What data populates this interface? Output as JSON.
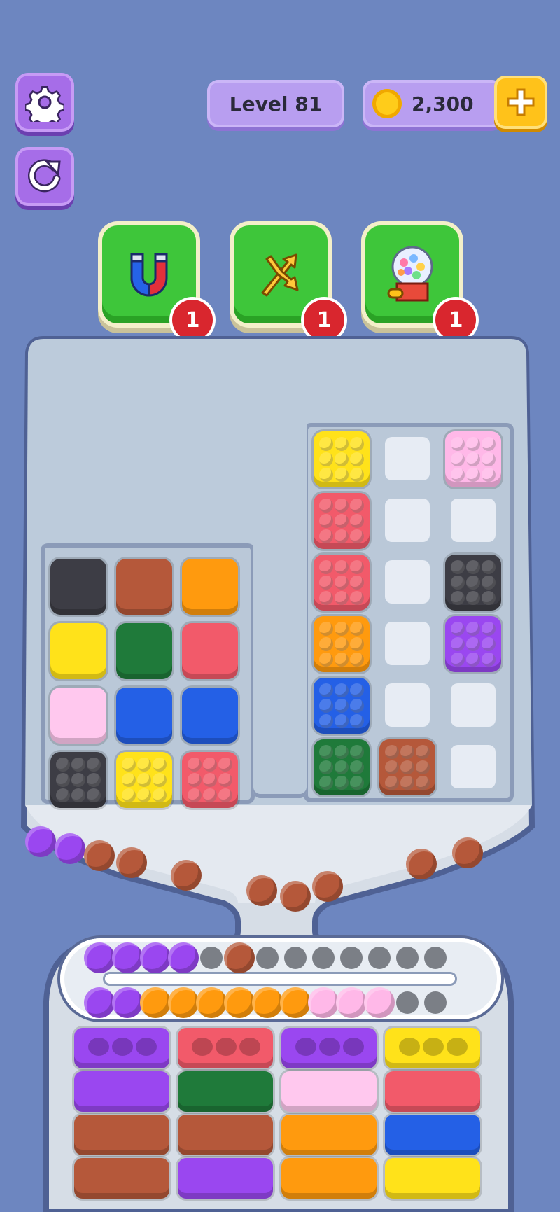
{
  "hud": {
    "level_label": "Level 81",
    "coins": "2,300",
    "settings_icon": "gear-icon",
    "restart_icon": "restart-icon",
    "coin_icon": "coin-icon",
    "add_icon": "plus-icon"
  },
  "boosters": [
    {
      "icon": "magnet-icon",
      "count": "1"
    },
    {
      "icon": "shuffle-arrows-icon",
      "count": "1"
    },
    {
      "icon": "gumball-machine-icon",
      "count": "1"
    }
  ],
  "colors": {
    "black": "#3d3d45",
    "brown": "#b5583a",
    "orange": "#ff9a0e",
    "yellow": "#ffe21a",
    "green": "#1f7a3a",
    "red": "#f25a6a",
    "pink": "#ffc8ee",
    "blue": "#2460e6",
    "purple": "#9a47f0",
    "light_pink": "#ffb8e8"
  },
  "left_grid": [
    [
      "black",
      "brown",
      "orange"
    ],
    [
      "yellow",
      "green",
      "red"
    ],
    [
      "pink",
      "blue",
      "blue"
    ],
    [
      "black",
      "yellow",
      "red"
    ]
  ],
  "right_grid": [
    [
      "yellow",
      "empty",
      "light_pink"
    ],
    [
      "red",
      "empty",
      "empty"
    ],
    [
      "red",
      "empty",
      "black"
    ],
    [
      "orange",
      "empty",
      "purple"
    ],
    [
      "blue",
      "empty",
      "empty"
    ],
    [
      "green",
      "brown",
      "empty"
    ]
  ],
  "conveyor": {
    "row1": [
      "purple",
      "purple",
      "purple",
      "purple",
      "hole",
      "brown",
      "hole",
      "hole",
      "hole",
      "hole",
      "hole",
      "hole",
      "hole"
    ],
    "row2": [
      "purple",
      "purple",
      "orange",
      "orange",
      "orange",
      "orange",
      "orange",
      "orange",
      "light_pink",
      "light_pink",
      "light_pink",
      "hole",
      "hole"
    ]
  },
  "trays": [
    [
      "purple",
      "purple",
      "brown",
      "brown"
    ],
    [
      "red",
      "green",
      "brown",
      "purple"
    ],
    [
      "purple",
      "pink",
      "orange",
      "orange"
    ],
    [
      "yellow",
      "red",
      "blue",
      "yellow"
    ]
  ]
}
